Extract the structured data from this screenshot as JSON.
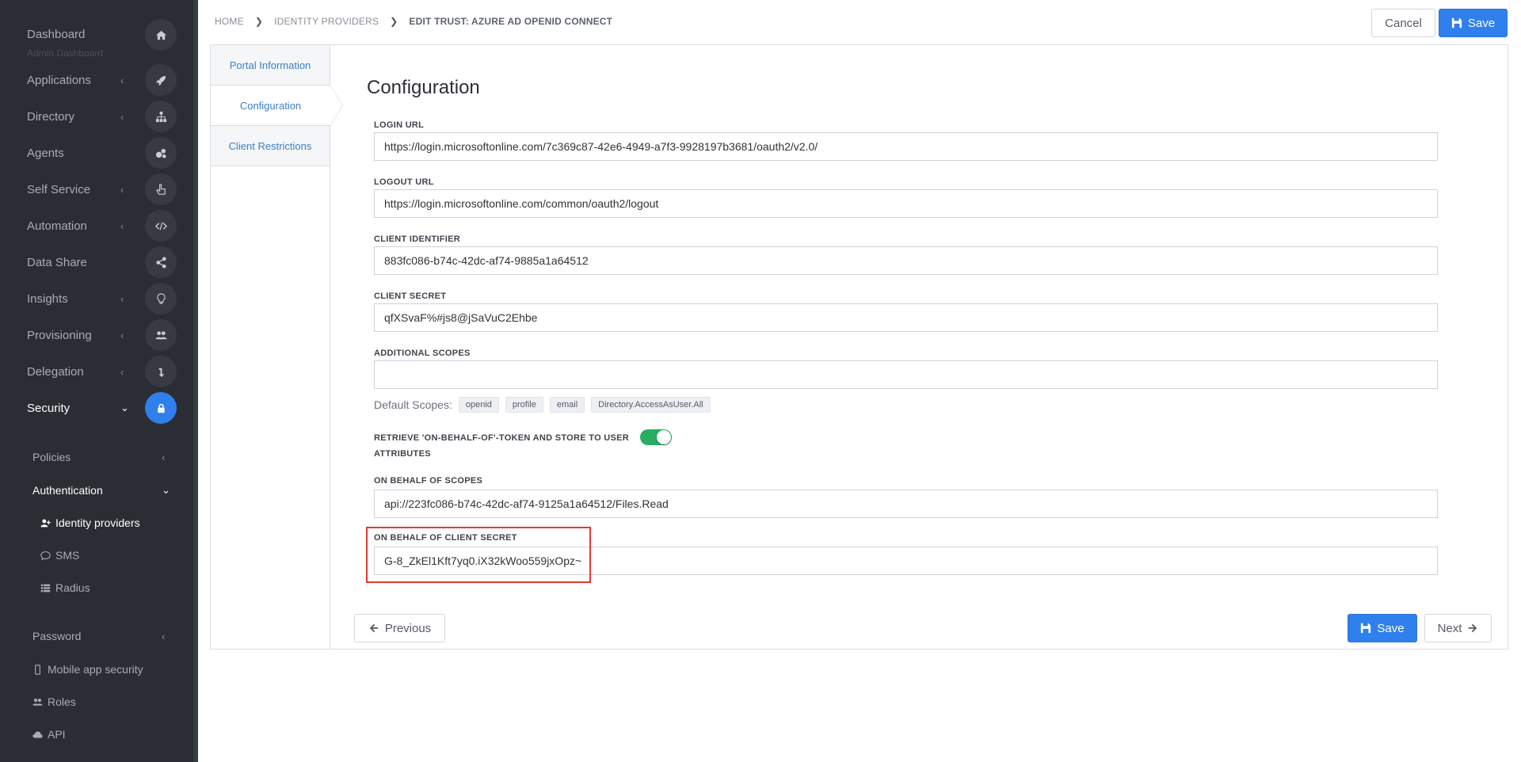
{
  "sidebar": {
    "dashboard_sub": "Admin Dashboard",
    "items": [
      {
        "label": "Dashboard",
        "chevron": "",
        "icon": "home-icon"
      },
      {
        "label": "Applications",
        "chevron": "‹",
        "icon": "rocket-icon"
      },
      {
        "label": "Directory",
        "chevron": "‹",
        "icon": "sitemap-icon"
      },
      {
        "label": "Agents",
        "chevron": "",
        "icon": "cogs-icon"
      },
      {
        "label": "Self Service",
        "chevron": "‹",
        "icon": "hand-pointer-icon"
      },
      {
        "label": "Automation",
        "chevron": "‹",
        "icon": "code-icon"
      },
      {
        "label": "Data Share",
        "chevron": "",
        "icon": "share-icon"
      },
      {
        "label": "Insights",
        "chevron": "‹",
        "icon": "lightbulb-icon"
      },
      {
        "label": "Provisioning",
        "chevron": "‹",
        "icon": "users-icon"
      },
      {
        "label": "Delegation",
        "chevron": "‹",
        "icon": "level-down-icon"
      },
      {
        "label": "Security",
        "chevron": "⌄",
        "icon": "lock-icon"
      }
    ],
    "subitems": [
      {
        "label": "Policies",
        "chevron": "‹"
      },
      {
        "label": "Authentication",
        "chevron": "⌄"
      },
      {
        "label": "Identity providers",
        "chevron": ""
      },
      {
        "label": "SMS",
        "chevron": ""
      },
      {
        "label": "Radius",
        "chevron": ""
      },
      {
        "label": "Password",
        "chevron": "‹"
      },
      {
        "label": "Mobile app security",
        "chevron": ""
      },
      {
        "label": "Roles",
        "chevron": ""
      },
      {
        "label": "API",
        "chevron": ""
      }
    ]
  },
  "breadcrumb": {
    "home": "HOME",
    "identity_providers": "IDENTITY PROVIDERS",
    "current": "EDIT TRUST: AZURE AD OPENID CONNECT"
  },
  "toolbar": {
    "cancel_label": "Cancel",
    "save_label": "Save"
  },
  "tabs": [
    {
      "label": "Portal Information"
    },
    {
      "label": "Configuration"
    },
    {
      "label": "Client Restrictions"
    }
  ],
  "form": {
    "title": "Configuration",
    "login_url": {
      "label": "LOGIN URL",
      "value": "https://login.microsoftonline.com/7c369c87-42e6-4949-a7f3-9928197b3681/oauth2/v2.0/"
    },
    "logout_url": {
      "label": "LOGOUT URL",
      "value": "https://login.microsoftonline.com/common/oauth2/logout"
    },
    "client_identifier": {
      "label": "CLIENT IDENTIFIER",
      "value": "883fc086-b74c-42dc-af74-9885a1a64512"
    },
    "client_secret": {
      "label": "CLIENT SECRET",
      "value": "qfXSvaF%#js8@jSaVuC2Ehbe"
    },
    "additional_scopes": {
      "label": "ADDITIONAL SCOPES",
      "value": ""
    },
    "default_scopes_label": "Default Scopes:",
    "default_scopes": [
      "openid",
      "profile",
      "email",
      "Directory.AccessAsUser.All"
    ],
    "obo_toggle": {
      "label": "RETRIEVE 'ON-BEHALF-OF'-TOKEN AND STORE TO USER ATTRIBUTES",
      "enabled": true
    },
    "obo_scopes": {
      "label": "ON BEHALF OF SCOPES",
      "value": "api://223fc086-b74c-42dc-af74-9125a1a64512/Files.Read"
    },
    "obo_client_secret": {
      "label": "ON BEHALF OF CLIENT SECRET",
      "value": "G-8_ZkEl1Kft7yq0.iX32kWoo559jxOpz~"
    }
  },
  "footer": {
    "previous_label": "Previous",
    "save_label": "Save",
    "next_label": "Next"
  },
  "colors": {
    "accent": "#2f80ed",
    "sidebar_bg": "#2b2d35",
    "toggle_on": "#27ae60",
    "highlight": "#e53935"
  }
}
